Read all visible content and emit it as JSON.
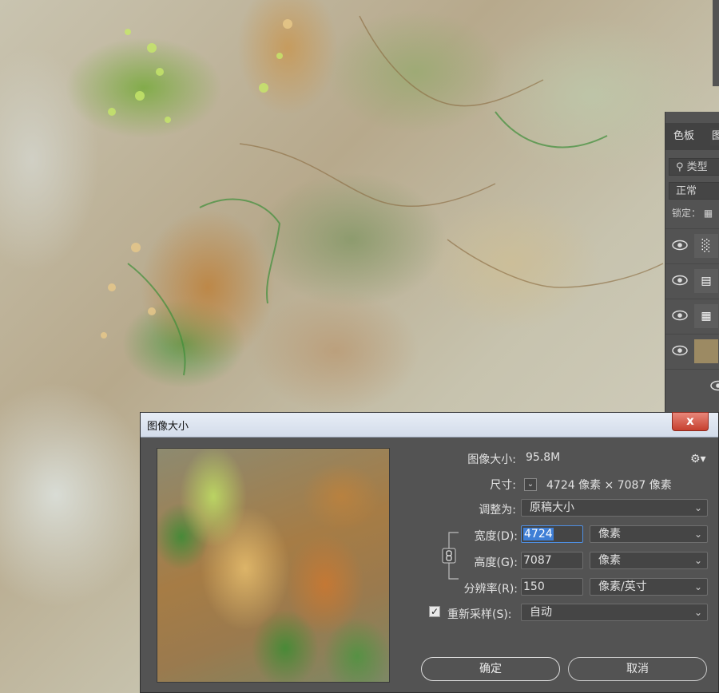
{
  "panel": {
    "tabs": [
      "色板",
      "图"
    ],
    "search_placeholder": "类型",
    "blend_mode": "正常",
    "lock_label": "锁定："
  },
  "dialog": {
    "title": "图像大小",
    "close_label": "x",
    "image_size_label": "图像大小:",
    "image_size_value": "95.8M",
    "dimensions_label": "尺寸:",
    "dimensions_value": "4724 像素  ×  7087 像素",
    "fit_to_label": "调整为:",
    "fit_to_value": "原稿大小",
    "width_label": "宽度(D):",
    "width_value": "4724",
    "width_unit": "像素",
    "height_label": "高度(G):",
    "height_value": "7087",
    "height_unit": "像素",
    "resolution_label": "分辨率(R):",
    "resolution_value": "150",
    "resolution_unit": "像素/英寸",
    "resample_label": "重新采样(S):",
    "resample_checked": true,
    "resample_value": "自动",
    "ok_label": "确定",
    "cancel_label": "取消"
  },
  "icons": {
    "gear": "gear-icon",
    "link": "chain-link-icon",
    "eye": "eye-icon",
    "chevron": "chevron-down-icon"
  }
}
